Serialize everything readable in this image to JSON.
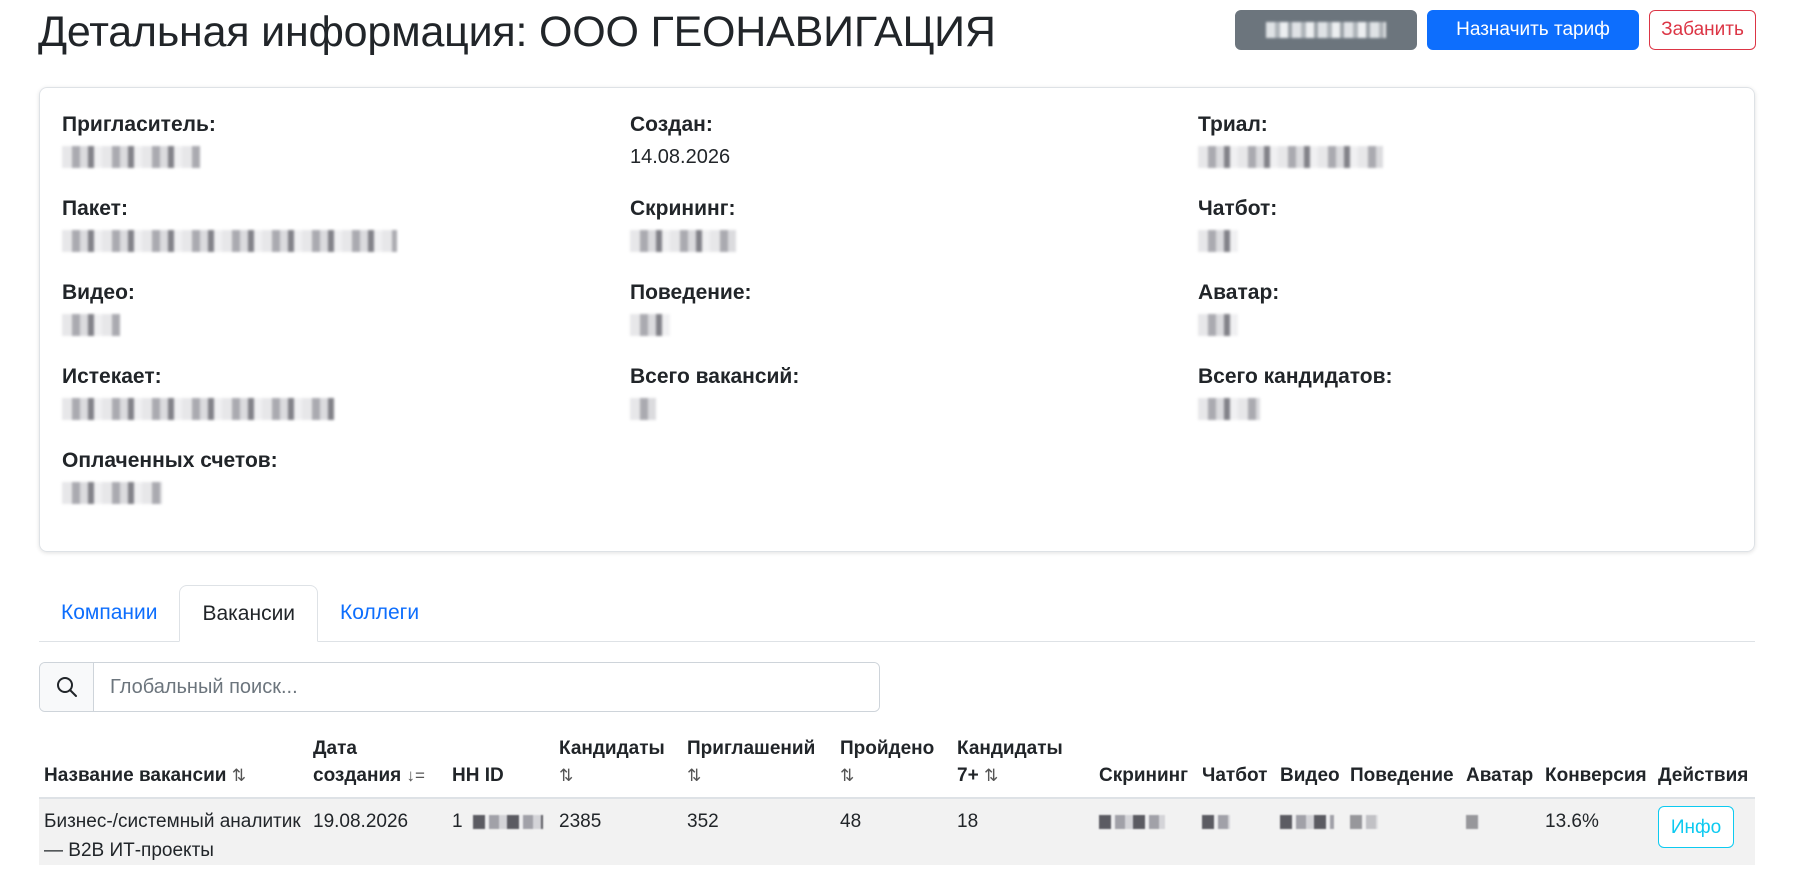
{
  "page": {
    "title": "Детальная информация: ООО ГЕОНАВИГАЦИЯ"
  },
  "actions": {
    "blurred_button_label": "",
    "assign_tariff": "Назначить тариф",
    "ban": "Забанить"
  },
  "info": [
    {
      "label": "Пригласитель:",
      "value": "",
      "blurred": true,
      "blur_width": 138
    },
    {
      "label": "Создан:",
      "value": "14.08.2026",
      "blurred": false
    },
    {
      "label": "Триал:",
      "value": "",
      "blurred": true,
      "blur_width": 185
    },
    {
      "label": "Пакет:",
      "value": "",
      "blurred": true,
      "blur_width": 335
    },
    {
      "label": "Скрининг:",
      "value": "",
      "blurred": true,
      "blur_width": 106
    },
    {
      "label": "Чатбот:",
      "value": "",
      "blurred": true,
      "blur_width": 40
    },
    {
      "label": "Видео:",
      "value": "",
      "blurred": true,
      "blur_width": 58
    },
    {
      "label": "Поведение:",
      "value": "",
      "blurred": true,
      "blur_width": 40
    },
    {
      "label": "Аватар:",
      "value": "",
      "blurred": true,
      "blur_width": 40
    },
    {
      "label": "Истекает:",
      "value": "",
      "blurred": true,
      "blur_width": 272
    },
    {
      "label": "Всего вакансий:",
      "value": "",
      "blurred": true,
      "blur_width": 26
    },
    {
      "label": "Всего кандидатов:",
      "value": "",
      "blurred": true,
      "blur_width": 62
    },
    {
      "label": "Оплаченных счетов:",
      "value": "",
      "blurred": true,
      "blur_width": 100
    }
  ],
  "tabs": [
    {
      "label": "Компании",
      "active": false
    },
    {
      "label": "Вакансии",
      "active": true
    },
    {
      "label": "Коллеги",
      "active": false
    }
  ],
  "search": {
    "placeholder": "Глобальный поиск...",
    "icon": "search-icon"
  },
  "table": {
    "columns": [
      {
        "label": "Название вакансии",
        "sort": "⇅"
      },
      {
        "label": "Дата создания",
        "sort": "↓="
      },
      {
        "label": "HH ID",
        "sort": ""
      },
      {
        "label": "Кандидаты",
        "sort": "⇅"
      },
      {
        "label": "Приглашений",
        "sort": "⇅"
      },
      {
        "label": "Пройдено",
        "sort": "⇅"
      },
      {
        "label": "Кандидаты 7+",
        "sort": "⇅"
      },
      {
        "label": "Скрининг",
        "sort": ""
      },
      {
        "label": "Чатбот",
        "sort": ""
      },
      {
        "label": "Видео",
        "sort": ""
      },
      {
        "label": "Поведение",
        "sort": ""
      },
      {
        "label": "Аватар",
        "sort": ""
      },
      {
        "label": "Конверсия",
        "sort": ""
      },
      {
        "label": "Действия",
        "sort": ""
      }
    ],
    "rows": [
      {
        "name": "Бизнес-/системный аналитик — B2B ИТ-проекты",
        "created": "19.08.2026",
        "hh_id": "1",
        "candidates": "2385",
        "invitations": "352",
        "passed": "48",
        "candidates7": "18",
        "conversion": "13.6%",
        "action": "Инфо"
      }
    ]
  }
}
